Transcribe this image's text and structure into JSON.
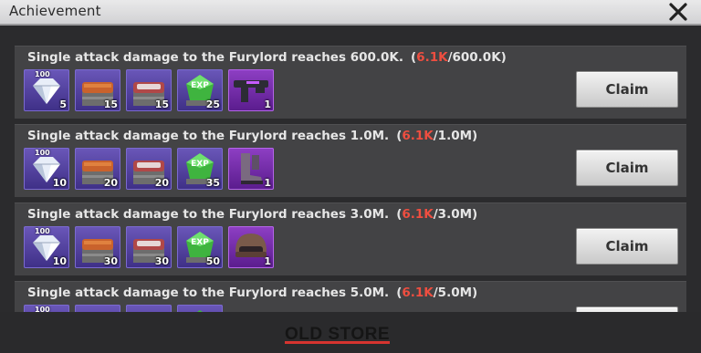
{
  "window": {
    "title": "Achievement"
  },
  "achievements": [
    {
      "title": "Single attack damage to the Furylord reaches 600.0K.",
      "progress_current": "6.1K",
      "progress_target": "/600.0K)",
      "progress_open": "(",
      "claim_label": "Claim",
      "rewards": [
        {
          "icon": "diamond-icon",
          "tag": "100",
          "qty": "5"
        },
        {
          "icon": "orange-chest-icon",
          "qty": "15"
        },
        {
          "icon": "red-chest-icon",
          "qty": "15"
        },
        {
          "icon": "exp-gem-icon",
          "qty": "25"
        },
        {
          "icon": "gun-icon",
          "qty": "1"
        }
      ]
    },
    {
      "title": "Single attack damage to the Furylord reaches 1.0M.",
      "progress_current": "6.1K",
      "progress_target": "/1.0M)",
      "progress_open": "(",
      "claim_label": "Claim",
      "rewards": [
        {
          "icon": "diamond-icon",
          "tag": "100",
          "qty": "10"
        },
        {
          "icon": "orange-chest-icon",
          "qty": "20"
        },
        {
          "icon": "red-chest-icon",
          "qty": "20"
        },
        {
          "icon": "exp-gem-icon",
          "qty": "35"
        },
        {
          "icon": "boots-icon",
          "qty": "1"
        }
      ]
    },
    {
      "title": "Single attack damage to the Furylord reaches 3.0M.",
      "progress_current": "6.1K",
      "progress_target": "/3.0M)",
      "progress_open": "(",
      "claim_label": "Claim",
      "rewards": [
        {
          "icon": "diamond-icon",
          "tag": "100",
          "qty": "10"
        },
        {
          "icon": "orange-chest-icon",
          "qty": "30"
        },
        {
          "icon": "red-chest-icon",
          "qty": "30"
        },
        {
          "icon": "exp-gem-icon",
          "qty": "50"
        },
        {
          "icon": "helmet-icon",
          "qty": "1"
        }
      ]
    },
    {
      "title": "Single attack damage to the Furylord reaches 5.0M.",
      "progress_current": "6.1K",
      "progress_target": "/5.0M)",
      "progress_open": "(",
      "rewards": [
        {
          "icon": "diamond-icon",
          "tag": "100"
        },
        {
          "icon": "orange-chest-icon"
        },
        {
          "icon": "red-chest-icon"
        },
        {
          "icon": "exp-gem-icon"
        }
      ]
    }
  ],
  "footer": {
    "link_label": "OLD STORE"
  },
  "colors": {
    "progress_current": "#ee4e40",
    "row_bg": "#434345",
    "underline": "#d7342f"
  }
}
